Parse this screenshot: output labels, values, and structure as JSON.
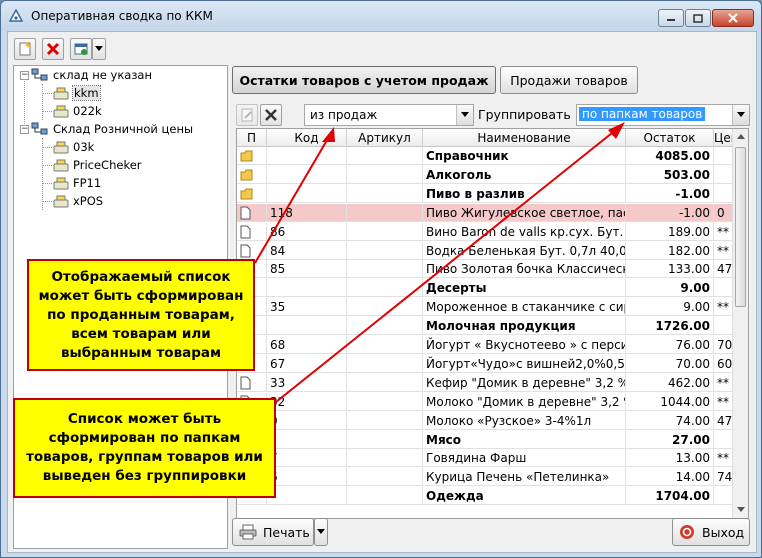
{
  "window": {
    "title": "Оперативная сводка по ККМ"
  },
  "tree": [
    {
      "label": "склад не указан",
      "kind": "store",
      "level": 0
    },
    {
      "label": "kkm",
      "kind": "kkm",
      "level": 1,
      "selected": true
    },
    {
      "label": "022k",
      "kind": "kkm",
      "level": 1
    },
    {
      "label": "Склад Розничной цены",
      "kind": "store",
      "level": 0
    },
    {
      "label": "03k",
      "kind": "kkm",
      "level": 1
    },
    {
      "label": "PriceCheker",
      "kind": "kkm",
      "level": 1
    },
    {
      "label": "FP11",
      "kind": "kkm",
      "level": 1
    },
    {
      "label": "xPOS",
      "kind": "kkm",
      "level": 1
    }
  ],
  "tabs": {
    "stock": "Остатки товаров с учетом продаж",
    "sales": "Продажи товаров"
  },
  "filter": {
    "source_value": "из продаж",
    "group_label": "Группировать",
    "group_value": "по папкам товаров"
  },
  "columns": [
    "П",
    "Код",
    "Артикул",
    "Наименование",
    "Остаток",
    "Цен"
  ],
  "rows": [
    {
      "type": "folder",
      "name": "Справочник",
      "qty": "4085.00"
    },
    {
      "type": "folder",
      "name": "Алкоголь",
      "qty": "503.00"
    },
    {
      "type": "folder",
      "name": "Пиво в разлив",
      "qty": "-1.00"
    },
    {
      "type": "item",
      "code": "118",
      "name": "Пиво Жигулевское светлое, паст",
      "qty": "-1.00",
      "price": "0",
      "highlight": true
    },
    {
      "type": "item",
      "code": "86",
      "name": "Вино Baron de valls кр.сух. Бут.",
      "qty": "189.00",
      "price": "**"
    },
    {
      "type": "item",
      "code": "84",
      "name": "Водка Беленькая  Бут. 0,7л 40,0",
      "qty": "182.00",
      "price": "**"
    },
    {
      "type": "item",
      "code": "85",
      "name": "Пиво Золотая бочка Классическ",
      "qty": "133.00",
      "price": "47"
    },
    {
      "type": "group",
      "name": "Десерты",
      "qty": "9.00"
    },
    {
      "type": "item",
      "code": "35",
      "name": "Мороженное в стаканчике с сир",
      "qty": "9.00",
      "price": "**"
    },
    {
      "type": "group",
      "name": "Молочная продукция",
      "qty": "1726.00"
    },
    {
      "type": "item",
      "code": "68",
      "name": "Йогурт « Вкуснотеево » с перси",
      "qty": "76.00",
      "price": "70"
    },
    {
      "type": "item",
      "code": "67",
      "name": "Йогурт«Чудо»с вишней2,0%0,5",
      "qty": "70.00",
      "price": "60"
    },
    {
      "type": "item",
      "code": "33",
      "name": "Кефир \"Домик в деревне\" 3,2 %",
      "qty": "462.00",
      "price": "**"
    },
    {
      "type": "item",
      "code": "32",
      "name": "Молоко \"Домик в деревне\" 3,2 %",
      "qty": "1044.00",
      "price": "**"
    },
    {
      "type": "item",
      "code": "0",
      "name": "Молоко «Рузское» 3-4%1л",
      "qty": "74.00",
      "price": "47"
    },
    {
      "type": "group",
      "name": "Мясо",
      "qty": "27.00"
    },
    {
      "type": "item",
      "code": "7",
      "name": "Говядина Фарш",
      "qty": "13.00",
      "price": "**"
    },
    {
      "type": "item",
      "code": "6",
      "name": "Курица Печень  «Петелинка»",
      "qty": "14.00",
      "price": "74"
    },
    {
      "type": "group",
      "name": "Одежда",
      "qty": "1704.00"
    }
  ],
  "callouts": {
    "first": "Отображаемый список может быть сформирован по проданным товарам, всем товарам или выбранным товарам",
    "second": "Список может быть сформирован по папкам товаров, группам товаров или выведен без группировки"
  },
  "bottom": {
    "print": "Печать",
    "exit": "Выход"
  },
  "colors": {
    "callout_fill": "#ffff00",
    "callout_border": "#c00000",
    "arrow": "#e00000",
    "highlight_row": "#f5c9c9"
  }
}
